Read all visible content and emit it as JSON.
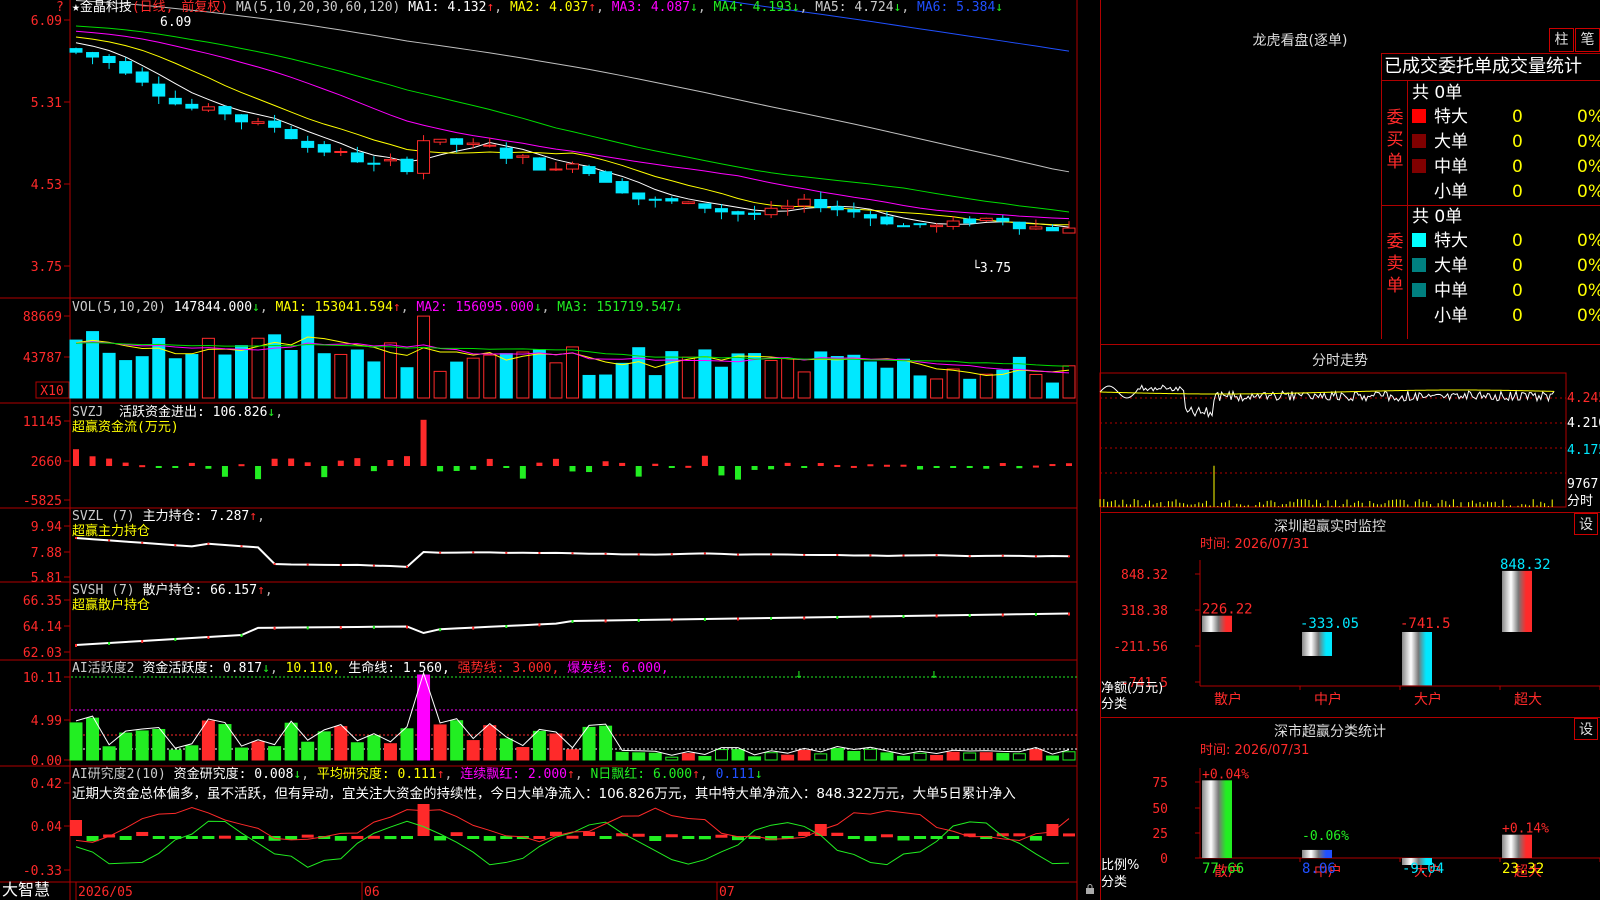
{
  "app": {
    "brand": "大智慧",
    "hdr_star": "★",
    "corner_mark": "?",
    "lock_icon": "lock-icon"
  },
  "colors": {
    "up": "#ff2a2a",
    "down": "#00e8ff",
    "ma1": "#ffffff",
    "ma2": "#ffff00",
    "ma3": "#ff00ff",
    "ma4": "#00dd00",
    "ma5": "#c0c0c0",
    "ma6": "#2050ff",
    "green": "#22ee22",
    "frame": "#b00000"
  },
  "kline": {
    "header": {
      "name": "金晶科技",
      "period": "(日线, 前复权)",
      "params": "MA(5,10,20,30,60,120)",
      "ma1": "MA1: 4.132",
      "ma1_a": "↑",
      "ma2": "MA2: 4.037",
      "ma2_a": "↑",
      "ma3": "MA3: 4.087",
      "ma3_a": "↓",
      "ma4": "MA4: 4.193",
      "ma4_a": "↓",
      "ma5": "MA5: 4.724",
      "ma5_a": "↓",
      "ma6": "MA6: 5.384",
      "ma6_a": "↓"
    },
    "yticks": [
      "6.09",
      "5.31",
      "4.53",
      "3.75"
    ],
    "max_label": "6.09",
    "min_label": "3.75",
    "ymin": 3.6,
    "ymax": 6.2
  },
  "volume": {
    "header": {
      "params": "VOL(5,10,20)",
      "val": "147844.000",
      "val_a": "↓",
      "ma1": "MA1: 153041.594",
      "ma1_a": "↑",
      "ma2": "MA2: 156095.000",
      "ma2_a": "↓",
      "ma3": "MA3: 151719.547",
      "ma3_a": "↓"
    },
    "yticks": [
      "88669",
      "43787"
    ],
    "unit": "X10"
  },
  "svzj": {
    "header": {
      "name": "SVZJ",
      "label": "活跃资金进出: 106.826",
      "label_a": "↓"
    },
    "title2": "超赢资金流(万元)",
    "yticks": [
      "11145",
      "2660",
      "-5825"
    ]
  },
  "svzl": {
    "header": {
      "name": "SVZL (7)",
      "label": "主力持仓: 7.287",
      "label_a": "↑"
    },
    "title2": "超赢主力持仓",
    "yticks": [
      "9.94",
      "7.88",
      "5.81"
    ]
  },
  "svsh": {
    "header": {
      "name": "SVSH (7)",
      "label": "散户持仓: 66.157",
      "label_a": "↑"
    },
    "title2": "超赢散户持仓",
    "yticks": [
      "66.35",
      "64.14",
      "62.03"
    ]
  },
  "ai1": {
    "header": {
      "name": "AI活跃度2",
      "label": "资金活跃度: 0.817",
      "label_a": "↓",
      "v2": "10.110,",
      "life": "生命线: 1.560,",
      "strong": "强势线: 3.000,",
      "burst": "爆发线: 6.000,"
    },
    "yticks": [
      "10.11",
      "4.99",
      "0.00"
    ]
  },
  "ai2": {
    "header": {
      "name": "AI研究度2(10)",
      "label": "资金研究度: 0.008",
      "label_a": "↓",
      "avg": "平均研究度: 0.111",
      "avg_a": "↑",
      "lx": "连续飘红: 2.000",
      "lx_a": "↑",
      "nr": "N日飘红: 6.000",
      "nr_a": "↑",
      "v": "0.111",
      "v_a": "↓"
    },
    "comment": "近期大资金总体偏多，虽不活跃，但有异动，宜关注大资金的持续性，今日大单净流入：106.826万元，其中特大单净流入：848.322万元，大单5日累计净入",
    "yticks": [
      "0.42",
      "0.04",
      "-0.33"
    ]
  },
  "xaxis": {
    "labels": [
      "2026/05",
      "06",
      "07"
    ]
  },
  "longhu": {
    "title": "龙虎看盘(逐单)",
    "btn1": "柱",
    "btn2": "笔",
    "subtitle": "已成交委托单成交量统计",
    "buy": {
      "side": "委买单",
      "total": "共 0单",
      "rows": [
        {
          "name": "特大",
          "count": "0",
          "pct": "0%",
          "color": "#ff0000"
        },
        {
          "name": "大单",
          "count": "0",
          "pct": "0%",
          "color": "#800000"
        },
        {
          "name": "中单",
          "count": "0",
          "pct": "0%",
          "color": "#800000"
        },
        {
          "name": "小单",
          "count": "0",
          "pct": "0%",
          "color": ""
        }
      ]
    },
    "sell": {
      "side": "委卖单",
      "total": "共 0单",
      "rows": [
        {
          "name": "特大",
          "count": "0",
          "pct": "0%",
          "color": "#00ffff"
        },
        {
          "name": "大单",
          "count": "0",
          "pct": "0%",
          "color": "#008080"
        },
        {
          "name": "中单",
          "count": "0",
          "pct": "0%",
          "color": "#008080"
        },
        {
          "name": "小单",
          "count": "0",
          "pct": "0%",
          "color": ""
        }
      ]
    }
  },
  "intraday": {
    "title": "分时走势",
    "yticks": [
      "4.245",
      "4.210",
      "4.175"
    ],
    "vol_label": "9767",
    "vol_unit": "分时"
  },
  "monitor": {
    "title": "深圳超赢实时监控",
    "settings": "设",
    "time": "时间: 2026/07/31",
    "yticks": [
      "848.32",
      "318.38",
      "-211.56",
      "-741.5"
    ],
    "ylabel": "净额(万元)",
    "xlabel": "分类",
    "chart_data": {
      "type": "bar",
      "categories": [
        "散户",
        "中户",
        "大户",
        "超大"
      ],
      "values": [
        226.22,
        -333.05,
        -741.5,
        848.32
      ],
      "labels": [
        "226.22",
        "-333.05",
        "-741.5",
        "848.32"
      ],
      "ylim": [
        -741.5,
        848.32
      ]
    }
  },
  "stats": {
    "title": "深市超赢分类统计",
    "settings": "设",
    "time": "时间: 2026/07/31",
    "yticks": [
      "75",
      "50",
      "25",
      "0"
    ],
    "ylabel": "比例%",
    "xlabel": "分类",
    "chart_data": {
      "type": "bar",
      "categories": [
        "散户",
        "中户",
        "大户",
        "超大"
      ],
      "values": [
        77.66,
        8.06,
        -9.04,
        23.32
      ],
      "labels": [
        "77.66",
        "8.06",
        "-9.04",
        "23.32"
      ],
      "changes": [
        "+0.04%",
        "-0.06%",
        "",
        "+0.14%"
      ],
      "ylim": [
        0,
        75
      ]
    }
  }
}
